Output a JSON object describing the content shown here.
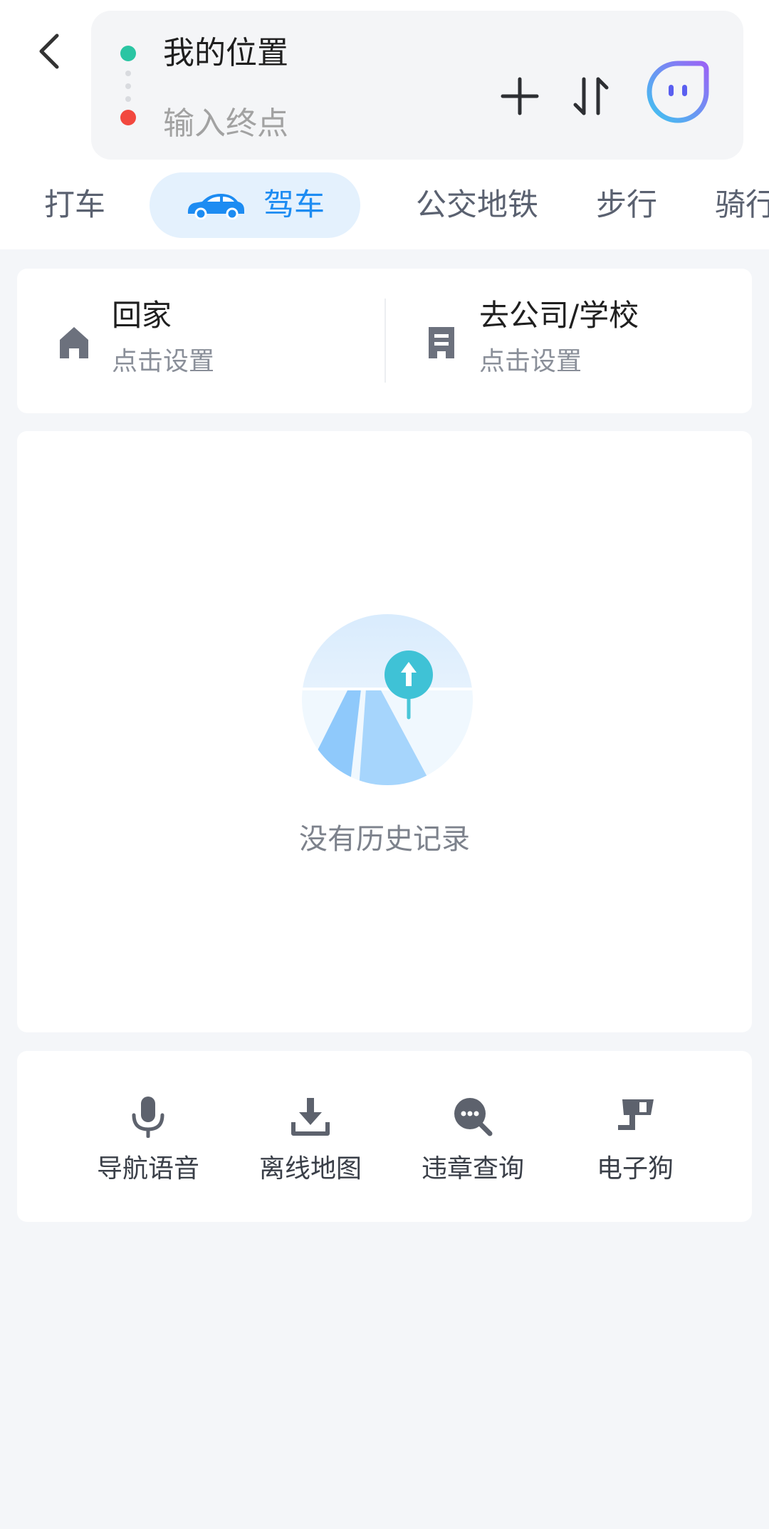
{
  "header": {
    "origin": "我的位置",
    "destination_placeholder": "输入终点",
    "colors": {
      "origin_dot": "#2ac5a3",
      "destination_dot": "#f2483f",
      "accent": "#1d8cf2"
    },
    "icons": [
      "back-arrow-icon",
      "plus-icon",
      "swap-icon",
      "ai-assistant-icon"
    ]
  },
  "tabs": [
    {
      "label": "打车",
      "active": false
    },
    {
      "label": "驾车",
      "active": true,
      "icon": "car-icon"
    },
    {
      "label": "公交地铁",
      "active": false
    },
    {
      "label": "步行",
      "active": false
    },
    {
      "label": "骑行",
      "active": false
    }
  ],
  "shortcuts": {
    "home": {
      "title": "回家",
      "subtitle": "点击设置",
      "icon": "home-icon"
    },
    "work": {
      "title": "去公司/学校",
      "subtitle": "点击设置",
      "icon": "building-icon"
    }
  },
  "history": {
    "empty_text": "没有历史记录"
  },
  "tools": [
    {
      "label": "导航语音",
      "icon": "microphone-icon"
    },
    {
      "label": "离线地图",
      "icon": "download-icon"
    },
    {
      "label": "违章查询",
      "icon": "search-chat-icon"
    },
    {
      "label": "电子狗",
      "icon": "camera-icon"
    }
  ]
}
